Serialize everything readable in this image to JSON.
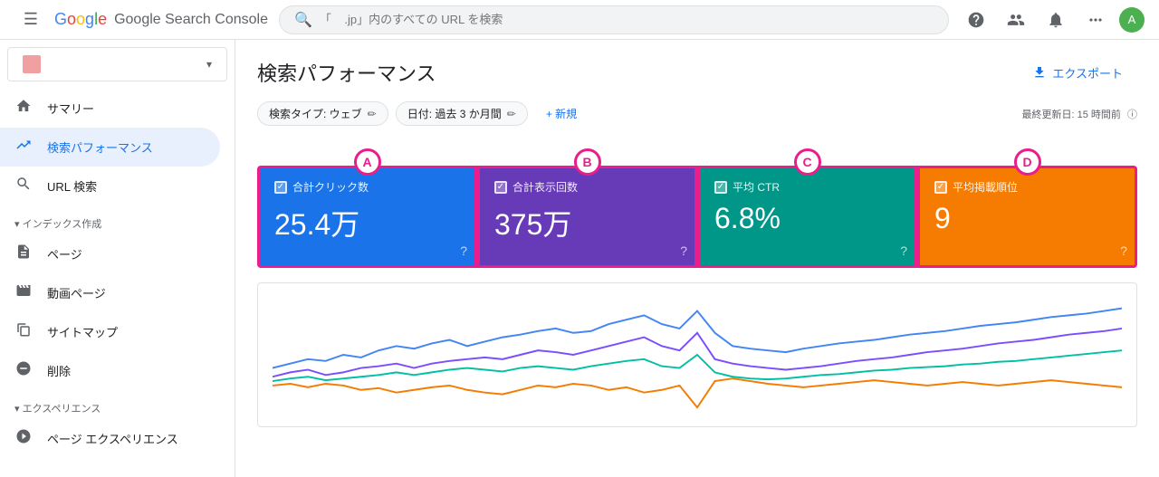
{
  "topbar": {
    "search_placeholder": "「    .jp」内のすべての URL を検索",
    "title": "Google Search Console"
  },
  "sidebar": {
    "site_name": "        ",
    "nav_items": [
      {
        "id": "summary",
        "label": "サマリー",
        "icon": "🏠",
        "active": false
      },
      {
        "id": "performance",
        "label": "検索パフォーマンス",
        "icon": "↗",
        "active": true
      },
      {
        "id": "url-inspection",
        "label": "URL 検索",
        "icon": "🔍",
        "active": false
      }
    ],
    "sections": [
      {
        "title": "インデックス作成",
        "items": [
          {
            "id": "pages",
            "label": "ページ",
            "icon": "📄"
          },
          {
            "id": "video-pages",
            "label": "動画ページ",
            "icon": "🎬"
          },
          {
            "id": "sitemap",
            "label": "サイトマップ",
            "icon": "🗺"
          },
          {
            "id": "removal",
            "label": "削除",
            "icon": "🚫"
          }
        ]
      },
      {
        "title": "エクスペリエンス",
        "items": [
          {
            "id": "page-experience",
            "label": "ページ エクスペリエンス",
            "icon": "➕"
          }
        ]
      }
    ]
  },
  "content": {
    "page_title": "検索パフォーマンス",
    "export_label": "エクスポート",
    "filter_search_type": "検索タイプ: ウェブ",
    "filter_date": "日付: 過去 3 か月間",
    "new_label": "+ 新規",
    "last_updated": "最終更新日: 15 時間前",
    "metrics": [
      {
        "id": "clicks",
        "label": "合計クリック数",
        "value": "25.4万",
        "badge": "A",
        "bg": "#1a73e8"
      },
      {
        "id": "impressions",
        "label": "合計表示回数",
        "value": "375万",
        "badge": "B",
        "bg": "#673ab7"
      },
      {
        "id": "ctr",
        "label": "平均 CTR",
        "value": "6.8%",
        "badge": "C",
        "bg": "#009688"
      },
      {
        "id": "position",
        "label": "平均掲載順位",
        "value": "9",
        "badge": "D",
        "bg": "#f57c00"
      }
    ]
  },
  "icons": {
    "hamburger": "☰",
    "search": "🔍",
    "help": "?",
    "accounts": "👤",
    "bell": "🔔",
    "apps": "⠿",
    "export": "⬇",
    "edit": "✏",
    "info": "?"
  }
}
